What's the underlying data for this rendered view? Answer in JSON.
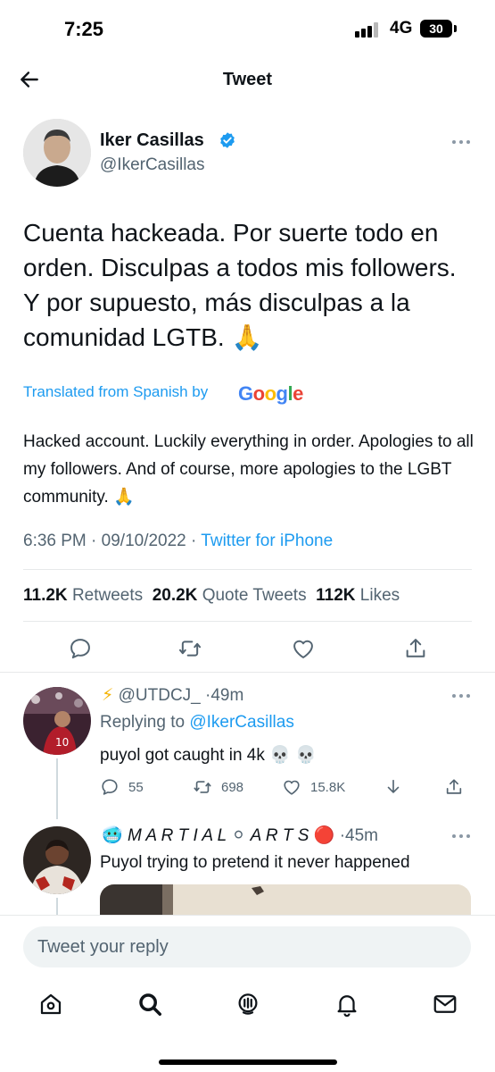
{
  "status_bar": {
    "time": "7:25",
    "network": "4G",
    "battery": "30"
  },
  "header": {
    "title": "Tweet",
    "back_icon": "arrow-left-icon"
  },
  "tweet": {
    "author_name": "Iker Casillas",
    "author_handle": "@IkerCasillas",
    "text": "Cuenta hackeada. Por suerte todo en orden. Disculpas a todos mis followers. Y por supuesto, más disculpas a la comunidad LGTB. 🙏",
    "translated_label": "Translated from Spanish by",
    "translation_provider": "Google",
    "translation": "Hacked account. Luckily everything in order. Apologies to all my followers. And of course, more apologies to the LGBT community. 🙏",
    "time": "6:36 PM",
    "date": "09/10/2022",
    "source": "Twitter for iPhone",
    "separator": "·",
    "stats": {
      "retweets_count": "11.2K",
      "retweets_label": "Retweets",
      "quotes_count": "20.2K",
      "quotes_label": "Quote Tweets",
      "likes_count": "112K",
      "likes_label": "Likes"
    }
  },
  "replies": [
    {
      "display_prefix": "⚡",
      "handle": "@UTDCJ_",
      "time": "49m",
      "replying_to_label": "Replying to",
      "replying_to": "@IkerCasillas",
      "text": "puyol got caught in 4k 💀 💀",
      "replies": "55",
      "retweets": "698",
      "likes": "15.8K"
    },
    {
      "display_prefix": "🥶",
      "display_name": "M A R T I A L",
      "display_mid": "⚪",
      "display_name_2": "A R T S",
      "display_suffix": "🔴",
      "time": "45m",
      "text": "Puyol trying to pretend it never happened"
    }
  ],
  "reply_bar": {
    "placeholder": "Tweet your reply"
  },
  "colors": {
    "accent": "#1d9bf0",
    "text": "#0f1419",
    "muted": "#536471",
    "divider": "#e7e9ea"
  },
  "nav_icons": [
    "home-icon",
    "search-icon",
    "spaces-icon",
    "notifications-icon",
    "messages-icon"
  ]
}
